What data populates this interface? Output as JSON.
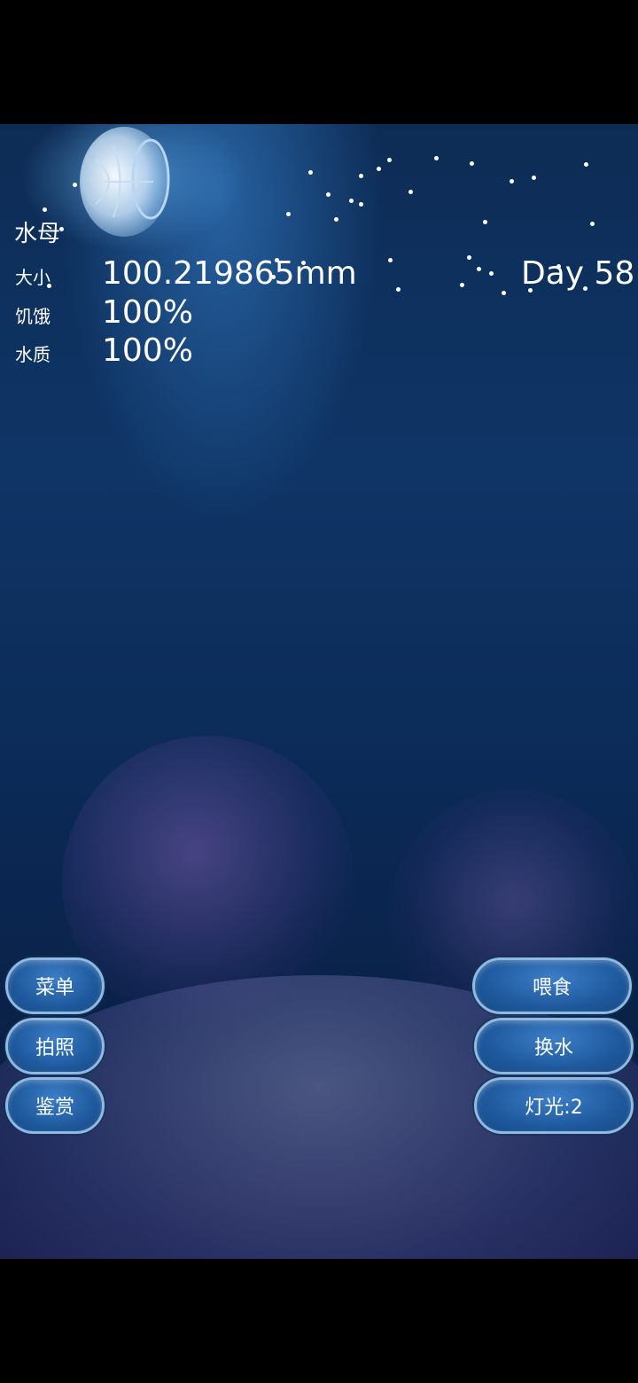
{
  "hud": {
    "title": "水母",
    "size_label": "大小",
    "size_value": "100.219865mm",
    "hunger_label": "饥饿",
    "hunger_value": "100%",
    "water_label": "水质",
    "water_value": "100%",
    "day": "Day 58"
  },
  "left_buttons": {
    "menu": "菜单",
    "photo": "拍照",
    "appreciate": "鉴赏"
  },
  "right_buttons": {
    "feed": "喂食",
    "change_water": "换水",
    "light": "灯光:2"
  },
  "colors": {
    "button_fill": "#1f5a9e",
    "button_border": "#8fb9de",
    "water": "#0f3566"
  }
}
